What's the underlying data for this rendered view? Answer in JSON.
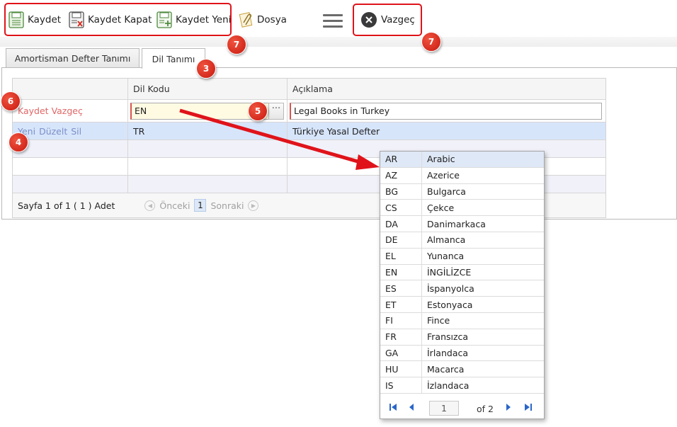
{
  "toolbar": {
    "save_label": "Kaydet",
    "save_close_label": "Kaydet Kapat",
    "save_new_label": "Kaydet Yeni",
    "file_label": "Dosya",
    "cancel_label": "Vazgeç"
  },
  "badges": {
    "b7a": "7",
    "b7b": "7",
    "b3": "3",
    "b6": "6",
    "b5": "5",
    "b4": "4"
  },
  "tabs": [
    {
      "label": "Amortisman Defter Tanımı",
      "active": false
    },
    {
      "label": "Dil Tanımı",
      "active": true
    }
  ],
  "grid": {
    "headers": [
      "",
      "Dil Kodu",
      "Açıklama"
    ],
    "edit_row": {
      "actions": [
        "Kaydet",
        "Vazgeç"
      ],
      "code": "EN",
      "description": "Legal Books in Turkey"
    },
    "rows": [
      {
        "actions": [
          "Yeni",
          "Düzelt",
          "Sil"
        ],
        "code": "TR",
        "description": "Türkiye Yasal Defter"
      }
    ],
    "pager": {
      "summary": "Sayfa 1 of 1 ( 1 ) Adet",
      "prev_label": "Önceki",
      "page": "1",
      "next_label": "Sonraki"
    }
  },
  "lookup": {
    "rows": [
      {
        "code": "AR",
        "name": "Arabic"
      },
      {
        "code": "AZ",
        "name": "Azerice"
      },
      {
        "code": "BG",
        "name": "Bulgarca"
      },
      {
        "code": "CS",
        "name": "Çekce"
      },
      {
        "code": "DA",
        "name": "Danimarkaca"
      },
      {
        "code": "DE",
        "name": "Almanca"
      },
      {
        "code": "EL",
        "name": "Yunanca"
      },
      {
        "code": "EN",
        "name": "İNGİLİZCE"
      },
      {
        "code": "ES",
        "name": "İspanyolca"
      },
      {
        "code": "ET",
        "name": "Estonyaca"
      },
      {
        "code": "FI",
        "name": "Fince"
      },
      {
        "code": "FR",
        "name": "Fransızca"
      },
      {
        "code": "GA",
        "name": "İrlandaca"
      },
      {
        "code": "HU",
        "name": "Macarca"
      },
      {
        "code": "IS",
        "name": "İzlandaca"
      }
    ],
    "page_value": "1",
    "of_pages": "of 2"
  },
  "colors": {
    "highlight": "#e0131a",
    "selected_row": "#d7e5fb",
    "nav_blue": "#2a66c8"
  }
}
